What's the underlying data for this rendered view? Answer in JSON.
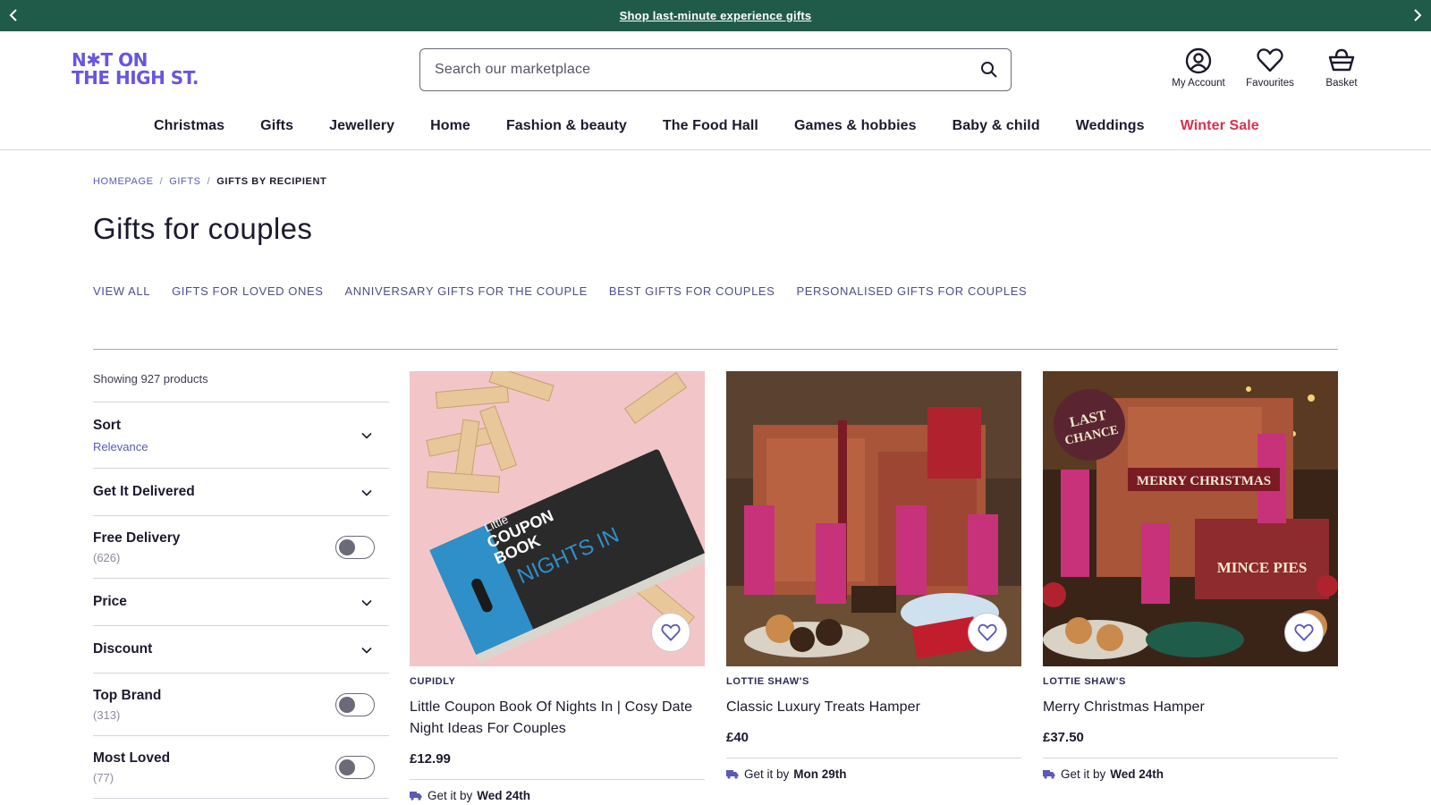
{
  "promo": {
    "text": "Shop last-minute experience gifts"
  },
  "logo": {
    "line1": "N✱T ON",
    "line2": "THE HIGH ST."
  },
  "search": {
    "placeholder": "Search our marketplace"
  },
  "header_icons": [
    {
      "label": "My Account",
      "icon": "account-icon"
    },
    {
      "label": "Favourites",
      "icon": "heart-icon"
    },
    {
      "label": "Basket",
      "icon": "basket-icon"
    }
  ],
  "nav": [
    "Christmas",
    "Gifts",
    "Jewellery",
    "Home",
    "Fashion & beauty",
    "The Food Hall",
    "Games & hobbies",
    "Baby & child",
    "Weddings",
    "Winter Sale"
  ],
  "breadcrumb": [
    "HOMEPAGE",
    "GIFTS",
    "GIFTS BY RECIPIENT"
  ],
  "page_title": "Gifts for couples",
  "subcategories": [
    "VIEW ALL",
    "GIFTS FOR LOVED ONES",
    "ANNIVERSARY GIFTS FOR THE COUPLE",
    "BEST GIFTS FOR COUPLES",
    "PERSONALISED GIFTS FOR COUPLES"
  ],
  "filters": {
    "showing": "Showing 927 products",
    "sort": {
      "title": "Sort",
      "value": "Relevance"
    },
    "get_it_delivered": "Get It Delivered",
    "free_delivery": {
      "title": "Free Delivery",
      "count": "(626)"
    },
    "price": "Price",
    "discount": "Discount",
    "top_brand": {
      "title": "Top Brand",
      "count": "(313)"
    },
    "most_loved": {
      "title": "Most Loved",
      "count": "(77)"
    }
  },
  "products": [
    {
      "brand": "CUPIDLY",
      "name": "Little Coupon Book Of Nights In | Cosy Date Night Ideas For Couples",
      "price": "£12.99",
      "delivery_prefix": "Get it by",
      "delivery_date": "Wed 24th",
      "image_text": {
        "line1": "Little",
        "line2": "COUPON",
        "line3": "BOOK",
        "line4": "NIGHTS IN"
      }
    },
    {
      "brand": "LOTTIE SHAW'S",
      "name": "Classic Luxury Treats Hamper",
      "price": "£40",
      "delivery_prefix": "Get it by",
      "delivery_date": "Mon 29th"
    },
    {
      "brand": "LOTTIE SHAW'S",
      "name": "Merry Christmas Hamper",
      "price": "£37.50",
      "delivery_prefix": "Get it by",
      "delivery_date": "Wed 24th",
      "image_text": {
        "badge1": "LAST",
        "badge2": "CHANCE",
        "banner": "MERRY CHRISTMAS",
        "box": "MINCE PIES"
      }
    }
  ],
  "colors": {
    "promo_bg": "#205b4a",
    "brand_purple": "#6856e0",
    "sale_red": "#d9304f"
  }
}
